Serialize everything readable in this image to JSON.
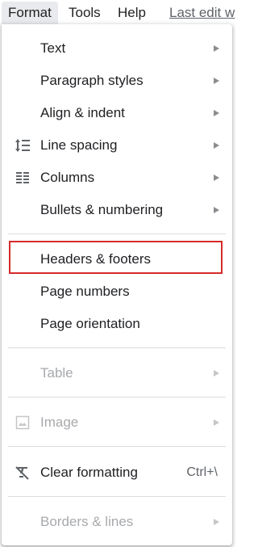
{
  "menubar": {
    "format": "Format",
    "tools": "Tools",
    "help": "Help",
    "last_edit": "Last edit w"
  },
  "menu": {
    "items": [
      {
        "label": "Text",
        "submenu": true,
        "disabled": false
      },
      {
        "label": "Paragraph styles",
        "submenu": true,
        "disabled": false
      },
      {
        "label": "Align & indent",
        "submenu": true,
        "disabled": false
      },
      {
        "label": "Line spacing",
        "submenu": true,
        "disabled": false,
        "icon": "line-spacing-icon"
      },
      {
        "label": "Columns",
        "submenu": true,
        "disabled": false,
        "icon": "columns-icon"
      },
      {
        "label": "Bullets & numbering",
        "submenu": true,
        "disabled": false
      },
      {
        "label": "Headers & footers",
        "submenu": false,
        "disabled": false,
        "highlighted": true
      },
      {
        "label": "Page numbers",
        "submenu": false,
        "disabled": false
      },
      {
        "label": "Page orientation",
        "submenu": false,
        "disabled": false
      },
      {
        "label": "Table",
        "submenu": true,
        "disabled": true
      },
      {
        "label": "Image",
        "submenu": true,
        "disabled": true,
        "icon": "image-icon"
      },
      {
        "label": "Clear formatting",
        "submenu": false,
        "disabled": false,
        "icon": "clear-formatting-icon",
        "shortcut": "Ctrl+\\"
      },
      {
        "label": "Borders & lines",
        "submenu": true,
        "disabled": true
      }
    ]
  },
  "colors": {
    "highlight_border": "#d62b2b",
    "active_menu_bg": "#e8eaed",
    "disabled_text": "#a7a9ac"
  }
}
